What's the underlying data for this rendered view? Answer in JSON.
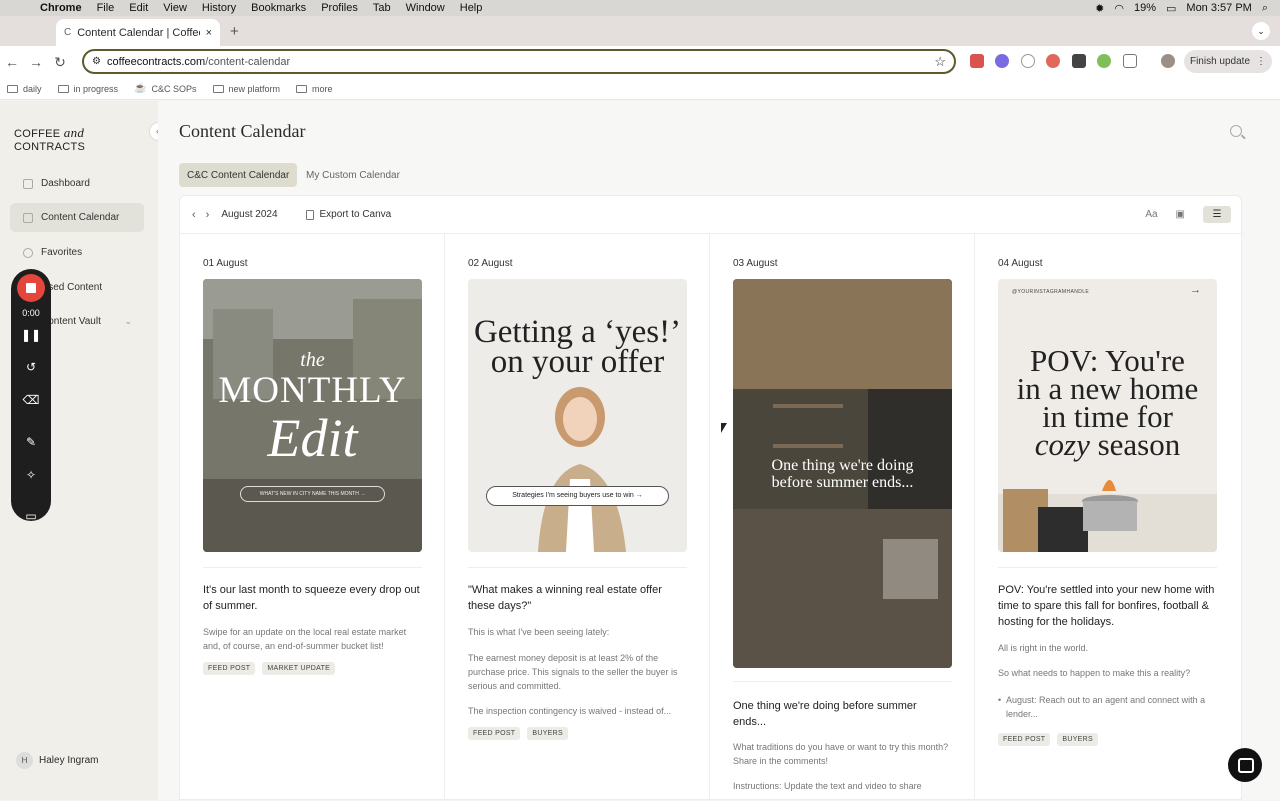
{
  "menubar": {
    "app": "Chrome",
    "items": [
      "File",
      "Edit",
      "View",
      "History",
      "Bookmarks",
      "Profiles",
      "Tab",
      "Window",
      "Help"
    ],
    "battery": "19%",
    "clock": "Mon 3:57 PM"
  },
  "tab": {
    "title": "Content Calendar | Coffee & C"
  },
  "omnibox": {
    "domain": "coffeecontracts.com",
    "path": "/content-calendar"
  },
  "toolbar": {
    "finish_update": "Finish update"
  },
  "bookmarks": [
    "daily",
    "in progress",
    "C&C SOPs",
    "new platform",
    "more"
  ],
  "sidebar": {
    "logo_left": "COFFEE",
    "logo_mid": "and",
    "logo_right": "CONTRACTS",
    "items": [
      {
        "label": "Dashboard"
      },
      {
        "label": "Content Calendar"
      },
      {
        "label": "Favorites"
      },
      {
        "label": "Used Content"
      },
      {
        "label": "Content Vault"
      }
    ],
    "user": {
      "initial": "H",
      "name": "Haley Ingram"
    }
  },
  "recorder": {
    "time": "0:00"
  },
  "page": {
    "title": "Content Calendar",
    "tabs": [
      "C&C Content Calendar",
      "My Custom Calendar"
    ],
    "month": "August 2024",
    "export": "Export to Canva",
    "text_icon": "Aa"
  },
  "days": [
    {
      "date": "01 August",
      "image": {
        "line1": "the",
        "line2": "MONTHLY",
        "line3": "Edit",
        "pill": "WHAT'S NEW IN CITY NAME THIS MONTH →"
      },
      "title": "It's our last month to squeeze every drop out of summer.",
      "paras": [
        "Swipe for an update on the local real estate market and, of course, an end-of-summer bucket list!"
      ],
      "tags": [
        "FEED POST",
        "MARKET UPDATE"
      ]
    },
    {
      "date": "02 August",
      "image": {
        "line1": "Getting a ‘yes!’",
        "line2": "on your offer",
        "pill": "Strategies I'm seeing buyers use to win →"
      },
      "title": "\"What makes a winning real estate offer these days?\"",
      "paras": [
        "This is what I've been seeing lately:",
        "The earnest money deposit is at least 2% of the purchase price. This signals to the seller the buyer is serious and committed.",
        "The inspection contingency is waived - instead of..."
      ],
      "tags": [
        "FEED POST",
        "BUYERS"
      ]
    },
    {
      "date": "03 August",
      "image": {
        "line1": "One thing we're doing",
        "line2": "before summer ends..."
      },
      "title": "One thing we're doing before summer ends...",
      "paras": [
        "What traditions do you have or want to try this month? Share in the comments!",
        "Instructions: Update the text and video to share"
      ],
      "tags": []
    },
    {
      "date": "04 August",
      "image": {
        "handle": "@YOURINSTAGRAMHANDLE",
        "line1": "POV: You're",
        "line2": "in a new home",
        "line3": "in time for",
        "line4a": "cozy",
        "line4b": "season"
      },
      "title": "POV: You're settled into your new home with time to spare this fall for bonfires, football & hosting for the holidays.",
      "paras": [
        "All is right in the world.",
        "So what needs to happen to make this a reality?",
        "August: Reach out to an agent and connect with a lender..."
      ],
      "tags": [
        "FEED POST",
        "BUYERS"
      ]
    }
  ]
}
